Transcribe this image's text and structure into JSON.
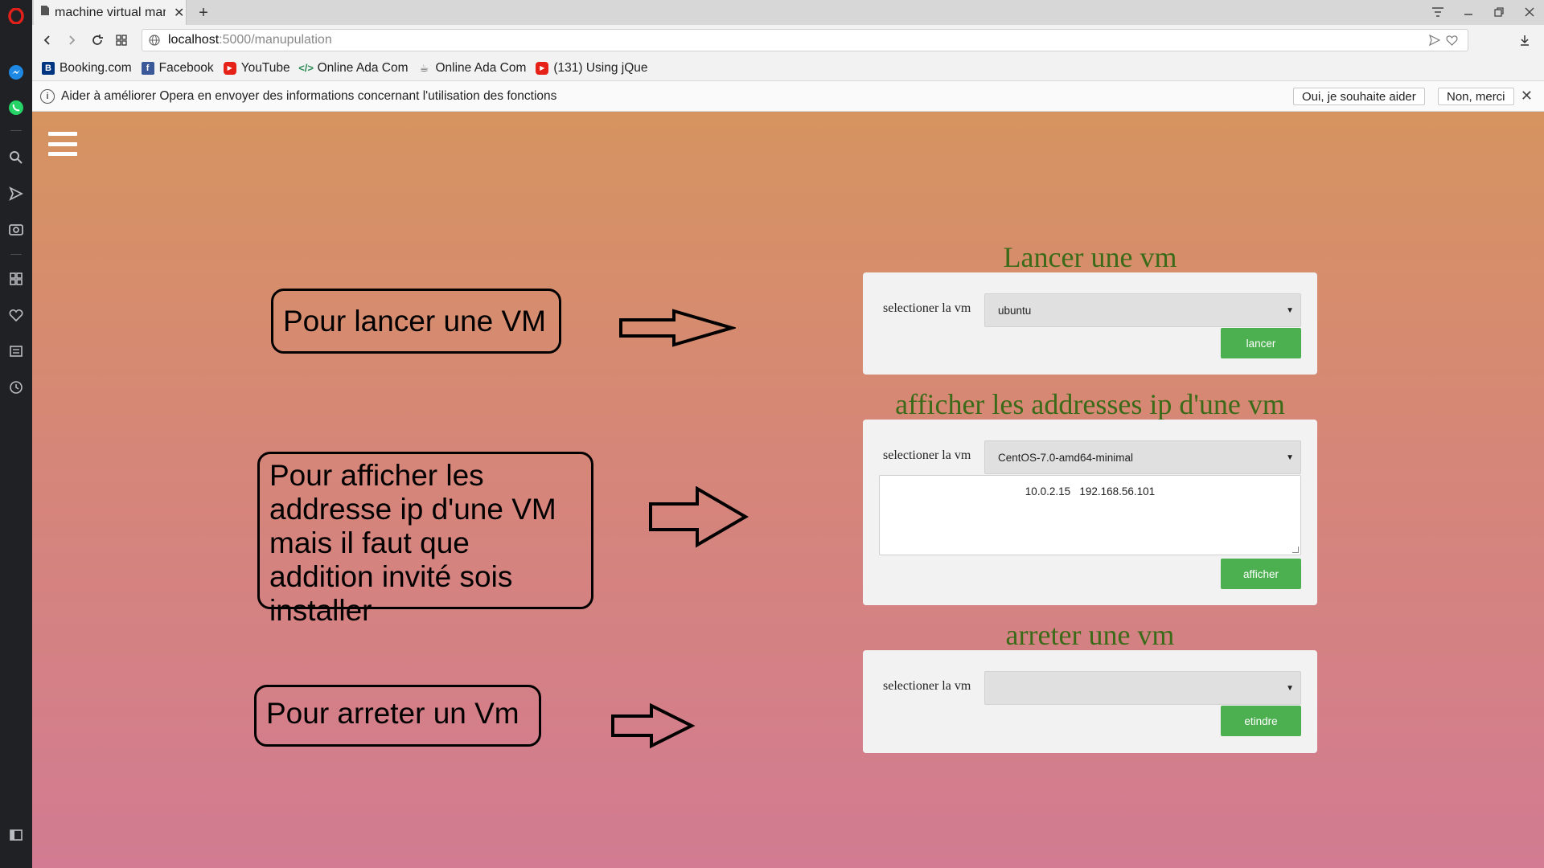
{
  "browser": {
    "tab_title": "machine virtual manu",
    "url_host": "localhost",
    "url_path": ":5000/manupulation",
    "bookmarks": [
      {
        "label": "Booking.com",
        "icon": "booking-icon",
        "color": "#003580"
      },
      {
        "label": "Facebook",
        "icon": "facebook-icon",
        "color": "#3b5998"
      },
      {
        "label": "YouTube",
        "icon": "youtube-icon",
        "color": "#e62117"
      },
      {
        "label": "Online Ada Com",
        "icon": "code-icon",
        "color": "#2e8b57"
      },
      {
        "label": "Online Ada Com",
        "icon": "java-cup-icon",
        "color": "#555555"
      },
      {
        "label": "(131) Using jQue",
        "icon": "youtube-icon",
        "color": "#e62117"
      }
    ],
    "infobar": {
      "message": "Aider à améliorer Opera en envoyer des informations concernant l'utilisation des fonctions",
      "accept_label": "Oui, je souhaite aider",
      "decline_label": "Non, merci"
    }
  },
  "page": {
    "callouts": [
      "Pour lancer une VM",
      "Pour afficher les addresse ip d'une VM mais il faut que addition invité sois installer",
      "Pour arreter un Vm"
    ],
    "sections": {
      "launch": {
        "title": "Lancer une vm",
        "label": "selectioner la vm",
        "selected": "ubuntu",
        "button": "lancer"
      },
      "ips": {
        "title": "afficher les addresses ip d'une vm",
        "label": "selectioner la vm",
        "selected": "CentOS-7.0-amd64-minimal",
        "ip_text": "10.0.2.15   192.168.56.101",
        "button": "afficher"
      },
      "stop": {
        "title": "arreter une vm",
        "label": "selectioner la vm",
        "selected": "",
        "button": "etindre"
      }
    }
  },
  "colors": {
    "accent_button": "#4caf50",
    "section_title": "#3b6b18",
    "sidebar": "#1f2124"
  }
}
